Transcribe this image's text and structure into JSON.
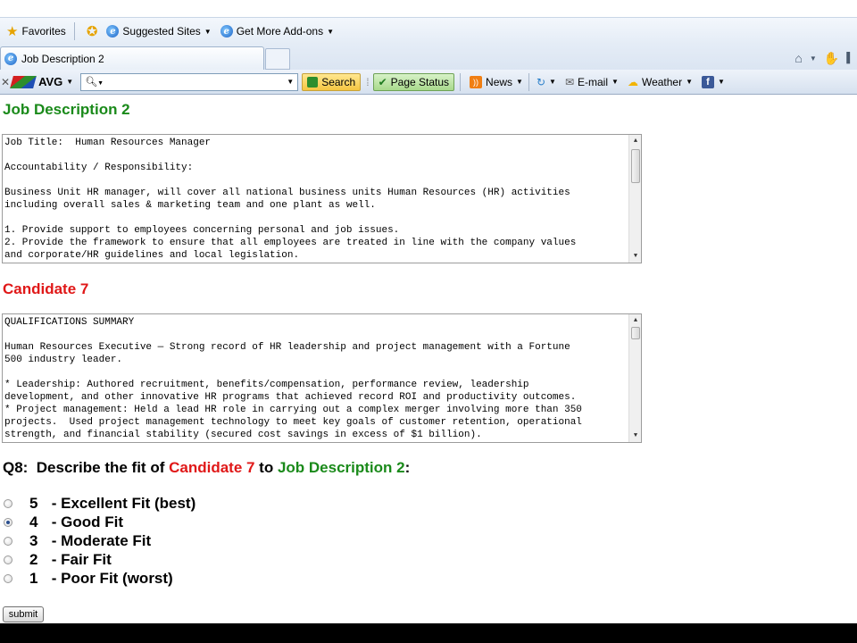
{
  "favorites_bar": {
    "favorites_label": "Favorites",
    "suggested_label": "Suggested Sites",
    "addons_label": "Get More Add-ons"
  },
  "tab": {
    "title": "Job Description 2"
  },
  "toolbar": {
    "avg_label": "AVG",
    "search_placeholder": "",
    "search_button": "Search",
    "page_status": "Page Status",
    "news": "News",
    "email": "E-mail",
    "weather": "Weather"
  },
  "job": {
    "heading": "Job Description 2",
    "text": "Job Title:  Human Resources Manager\n\nAccountability / Responsibility:\n\nBusiness Unit HR manager, will cover all national business units Human Resources (HR) activities\nincluding overall sales & marketing team and one plant as well.\n\n1. Provide support to employees concerning personal and job issues.\n2. Provide the framework to ensure that all employees are treated in line with the company values\nand corporate/HR guidelines and local legislation."
  },
  "candidate": {
    "heading": "Candidate 7",
    "text": "QUALIFICATIONS SUMMARY\n\nHuman Resources Executive — Strong record of HR leadership and project management with a Fortune\n500 industry leader.\n\n* Leadership: Authored recruitment, benefits/compensation, performance review, leadership\ndevelopment, and other innovative HR programs that achieved record ROI and productivity outcomes.\n* Project management: Held a lead HR role in carrying out a complex merger involving more than 350\nprojects.  Used project management technology to meet key goals of customer retention, operational\nstrength, and financial stability (secured cost savings in excess of $1 billion)."
  },
  "question": {
    "prefix": "Q8:  Describe the fit of ",
    "candidate": "Candidate 7",
    "middle": " to ",
    "job": "Job Description 2",
    "suffix": ":"
  },
  "options": [
    {
      "num": "5",
      "label": " - Excellent Fit (best)",
      "selected": false
    },
    {
      "num": "4",
      "label": " - Good Fit",
      "selected": true
    },
    {
      "num": "3",
      "label": " - Moderate Fit",
      "selected": false
    },
    {
      "num": "2",
      "label": " - Fair Fit",
      "selected": false
    },
    {
      "num": "1",
      "label": " - Poor Fit (worst)",
      "selected": false
    }
  ],
  "submit_label": "submit",
  "colors": {
    "green_heading": "#1a8a1a",
    "red_heading": "#e01818"
  }
}
